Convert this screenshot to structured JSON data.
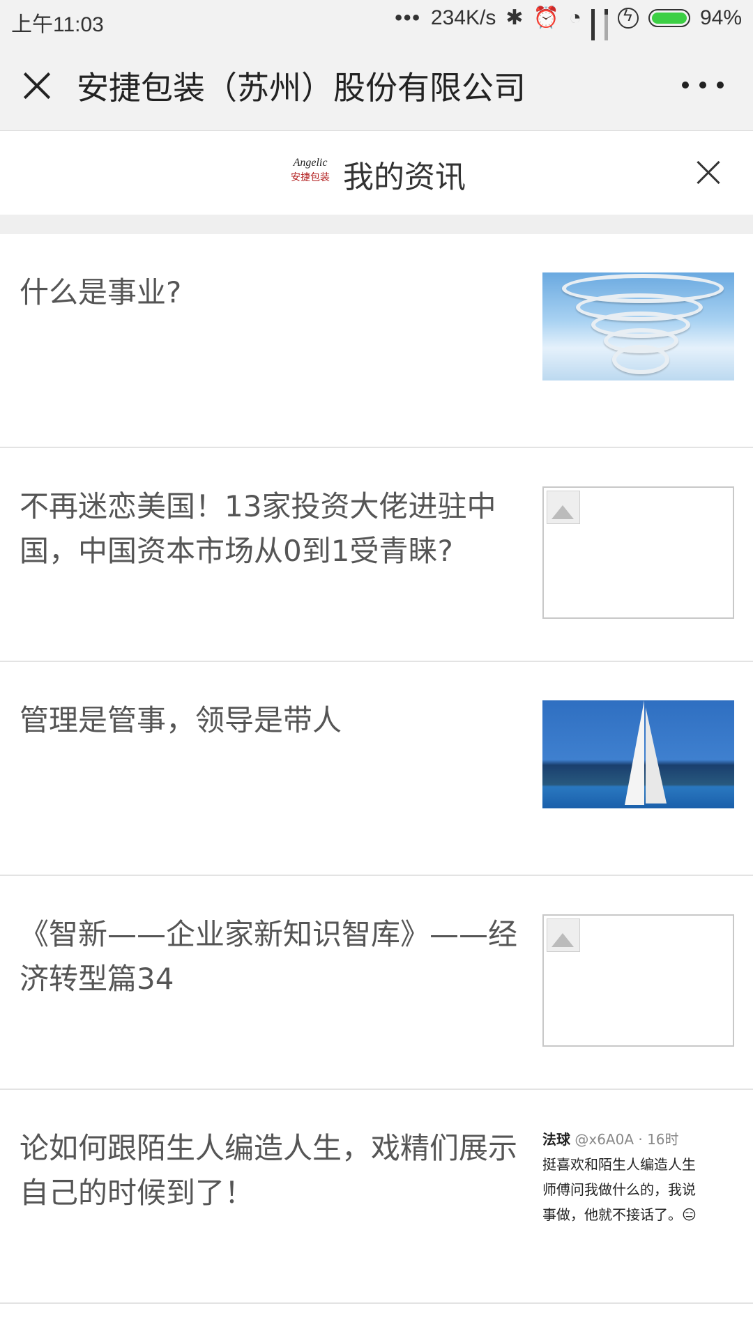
{
  "status_bar": {
    "time": "上午11:03",
    "dots": "•••",
    "speed": "234K/s",
    "bluetooth_icon": "bluetooth-icon",
    "alarm_icon": "alarm-icon",
    "wifi_icon": "wifi-icon",
    "signal_label": "HD",
    "battery_percent": "94%",
    "battery_level": 0.94
  },
  "header": {
    "title": "安捷包装（苏州）股份有限公司"
  },
  "sub_header": {
    "logo_text_top": "Angelic",
    "logo_text_bottom": "安捷包装",
    "title": "我的资讯"
  },
  "news": [
    {
      "title": "什么是事业?",
      "thumb": "sky"
    },
    {
      "title": "不再迷恋美国！13家投资大佬进驻中国，中国资本市场从0到1受青睐?",
      "thumb": "broken"
    },
    {
      "title": "管理是管事，领导是带人",
      "thumb": "sail"
    },
    {
      "title": "《智新——企业家新知识智库》——经济转型篇34",
      "thumb": "broken"
    },
    {
      "title": "论如何跟陌生人编造人生，戏精们展示自己的时候到了！",
      "thumb": "tweet"
    }
  ],
  "tweet": {
    "name": "法球",
    "handle": "@x6A0A · 16时",
    "line1": "挺喜欢和陌生人编造人生",
    "line2": "师傅问我做什么的，我说",
    "line3": "事做，他就不接话了。😑"
  }
}
